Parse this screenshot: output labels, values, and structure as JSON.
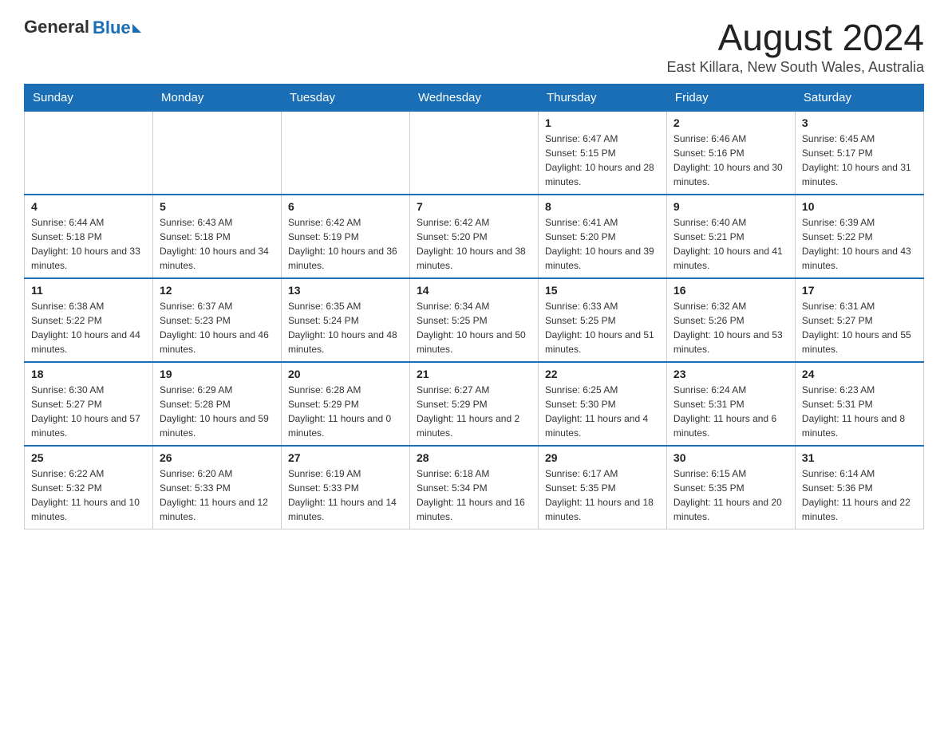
{
  "logo": {
    "general": "General",
    "blue": "Blue"
  },
  "title": {
    "month": "August 2024",
    "location": "East Killara, New South Wales, Australia"
  },
  "headers": [
    "Sunday",
    "Monday",
    "Tuesday",
    "Wednesday",
    "Thursday",
    "Friday",
    "Saturday"
  ],
  "weeks": [
    [
      {
        "day": "",
        "info": ""
      },
      {
        "day": "",
        "info": ""
      },
      {
        "day": "",
        "info": ""
      },
      {
        "day": "",
        "info": ""
      },
      {
        "day": "1",
        "info": "Sunrise: 6:47 AM\nSunset: 5:15 PM\nDaylight: 10 hours and 28 minutes."
      },
      {
        "day": "2",
        "info": "Sunrise: 6:46 AM\nSunset: 5:16 PM\nDaylight: 10 hours and 30 minutes."
      },
      {
        "day": "3",
        "info": "Sunrise: 6:45 AM\nSunset: 5:17 PM\nDaylight: 10 hours and 31 minutes."
      }
    ],
    [
      {
        "day": "4",
        "info": "Sunrise: 6:44 AM\nSunset: 5:18 PM\nDaylight: 10 hours and 33 minutes."
      },
      {
        "day": "5",
        "info": "Sunrise: 6:43 AM\nSunset: 5:18 PM\nDaylight: 10 hours and 34 minutes."
      },
      {
        "day": "6",
        "info": "Sunrise: 6:42 AM\nSunset: 5:19 PM\nDaylight: 10 hours and 36 minutes."
      },
      {
        "day": "7",
        "info": "Sunrise: 6:42 AM\nSunset: 5:20 PM\nDaylight: 10 hours and 38 minutes."
      },
      {
        "day": "8",
        "info": "Sunrise: 6:41 AM\nSunset: 5:20 PM\nDaylight: 10 hours and 39 minutes."
      },
      {
        "day": "9",
        "info": "Sunrise: 6:40 AM\nSunset: 5:21 PM\nDaylight: 10 hours and 41 minutes."
      },
      {
        "day": "10",
        "info": "Sunrise: 6:39 AM\nSunset: 5:22 PM\nDaylight: 10 hours and 43 minutes."
      }
    ],
    [
      {
        "day": "11",
        "info": "Sunrise: 6:38 AM\nSunset: 5:22 PM\nDaylight: 10 hours and 44 minutes."
      },
      {
        "day": "12",
        "info": "Sunrise: 6:37 AM\nSunset: 5:23 PM\nDaylight: 10 hours and 46 minutes."
      },
      {
        "day": "13",
        "info": "Sunrise: 6:35 AM\nSunset: 5:24 PM\nDaylight: 10 hours and 48 minutes."
      },
      {
        "day": "14",
        "info": "Sunrise: 6:34 AM\nSunset: 5:25 PM\nDaylight: 10 hours and 50 minutes."
      },
      {
        "day": "15",
        "info": "Sunrise: 6:33 AM\nSunset: 5:25 PM\nDaylight: 10 hours and 51 minutes."
      },
      {
        "day": "16",
        "info": "Sunrise: 6:32 AM\nSunset: 5:26 PM\nDaylight: 10 hours and 53 minutes."
      },
      {
        "day": "17",
        "info": "Sunrise: 6:31 AM\nSunset: 5:27 PM\nDaylight: 10 hours and 55 minutes."
      }
    ],
    [
      {
        "day": "18",
        "info": "Sunrise: 6:30 AM\nSunset: 5:27 PM\nDaylight: 10 hours and 57 minutes."
      },
      {
        "day": "19",
        "info": "Sunrise: 6:29 AM\nSunset: 5:28 PM\nDaylight: 10 hours and 59 minutes."
      },
      {
        "day": "20",
        "info": "Sunrise: 6:28 AM\nSunset: 5:29 PM\nDaylight: 11 hours and 0 minutes."
      },
      {
        "day": "21",
        "info": "Sunrise: 6:27 AM\nSunset: 5:29 PM\nDaylight: 11 hours and 2 minutes."
      },
      {
        "day": "22",
        "info": "Sunrise: 6:25 AM\nSunset: 5:30 PM\nDaylight: 11 hours and 4 minutes."
      },
      {
        "day": "23",
        "info": "Sunrise: 6:24 AM\nSunset: 5:31 PM\nDaylight: 11 hours and 6 minutes."
      },
      {
        "day": "24",
        "info": "Sunrise: 6:23 AM\nSunset: 5:31 PM\nDaylight: 11 hours and 8 minutes."
      }
    ],
    [
      {
        "day": "25",
        "info": "Sunrise: 6:22 AM\nSunset: 5:32 PM\nDaylight: 11 hours and 10 minutes."
      },
      {
        "day": "26",
        "info": "Sunrise: 6:20 AM\nSunset: 5:33 PM\nDaylight: 11 hours and 12 minutes."
      },
      {
        "day": "27",
        "info": "Sunrise: 6:19 AM\nSunset: 5:33 PM\nDaylight: 11 hours and 14 minutes."
      },
      {
        "day": "28",
        "info": "Sunrise: 6:18 AM\nSunset: 5:34 PM\nDaylight: 11 hours and 16 minutes."
      },
      {
        "day": "29",
        "info": "Sunrise: 6:17 AM\nSunset: 5:35 PM\nDaylight: 11 hours and 18 minutes."
      },
      {
        "day": "30",
        "info": "Sunrise: 6:15 AM\nSunset: 5:35 PM\nDaylight: 11 hours and 20 minutes."
      },
      {
        "day": "31",
        "info": "Sunrise: 6:14 AM\nSunset: 5:36 PM\nDaylight: 11 hours and 22 minutes."
      }
    ]
  ]
}
